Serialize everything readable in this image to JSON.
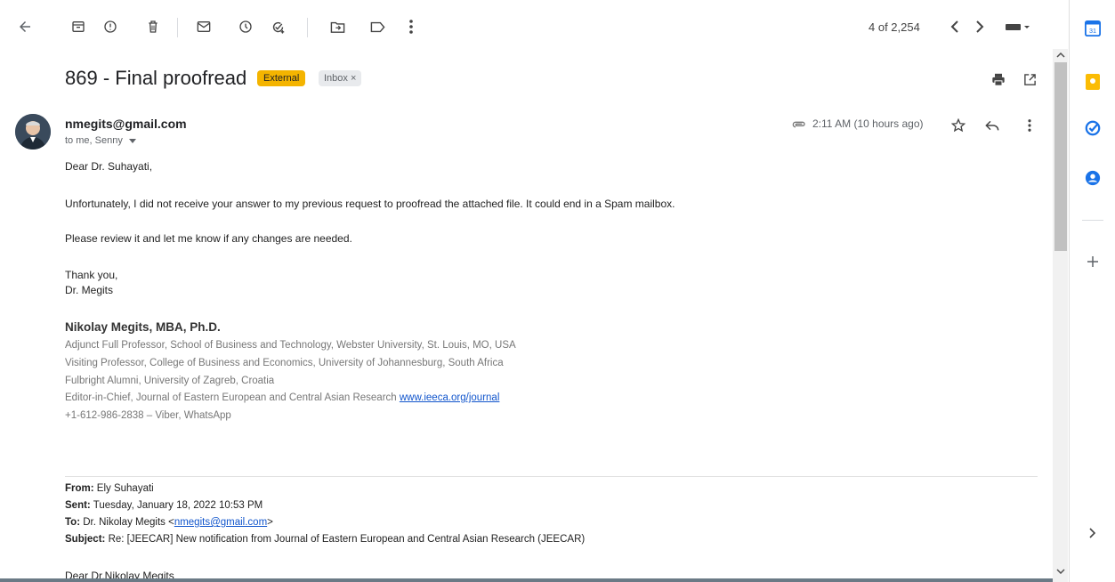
{
  "toolbar": {
    "page_count": "4 of 2,254"
  },
  "email": {
    "subject": "869 - Final proofread",
    "tags": {
      "external": "External",
      "inbox": "Inbox ×"
    },
    "sender": "nmegits@gmail.com",
    "recipients": "to me, Senny",
    "time": "2:11 AM (10 hours ago)",
    "greeting": "Dear Dr. Suhayati,",
    "paragraph1": "Unfortunately, I did not receive your answer to my previous request to proofread the attached file. It could end in a Spam mailbox.",
    "paragraph2": "Please review it and let me know if any changes are needed.",
    "closing": "Thank you,",
    "closing_name": "Dr. Megits"
  },
  "signature": {
    "name": "Nikolay Megits, MBA, Ph.D.",
    "line1": "Adjunct Full Professor, School of Business and Technology, Webster University, St. Louis, MO, USA",
    "line2": "Visiting Professor, College of Business and Economics, University of Johannesburg, South Africa",
    "line3": "Fulbright Alumni, University of Zagreb, Croatia",
    "line4_prefix": "Editor-in-Chief, Journal of Eastern European and Central Asian Research ",
    "line4_link": "www.ieeca.org/journal",
    "line5": "+1-612-986-2838 – Viber, WhatsApp"
  },
  "forwarded": {
    "from_label": "From:",
    "from_value": " Ely Suhayati",
    "sent_label": "Sent:",
    "sent_value": " Tuesday, January 18, 2022 10:53 PM",
    "to_label": "To:",
    "to_value": " Dr. Nikolay Megits <",
    "to_link": "nmegits@gmail.com",
    "to_suffix": ">",
    "subject_label": "Subject:",
    "subject_value": " Re: [JEECAR] New notification from Journal of Eastern European and Central Asian Research (JEECAR)",
    "greeting": "Dear Dr.Nikolay Megits"
  },
  "colors": {
    "external_tag": "#f4b400",
    "link": "#1155cc",
    "calendar": "#1a73e8",
    "keep": "#fbbc04",
    "tasks": "#1a73e8",
    "contacts": "#1a73e8"
  },
  "side_panel": {
    "calendar_day": "31"
  }
}
